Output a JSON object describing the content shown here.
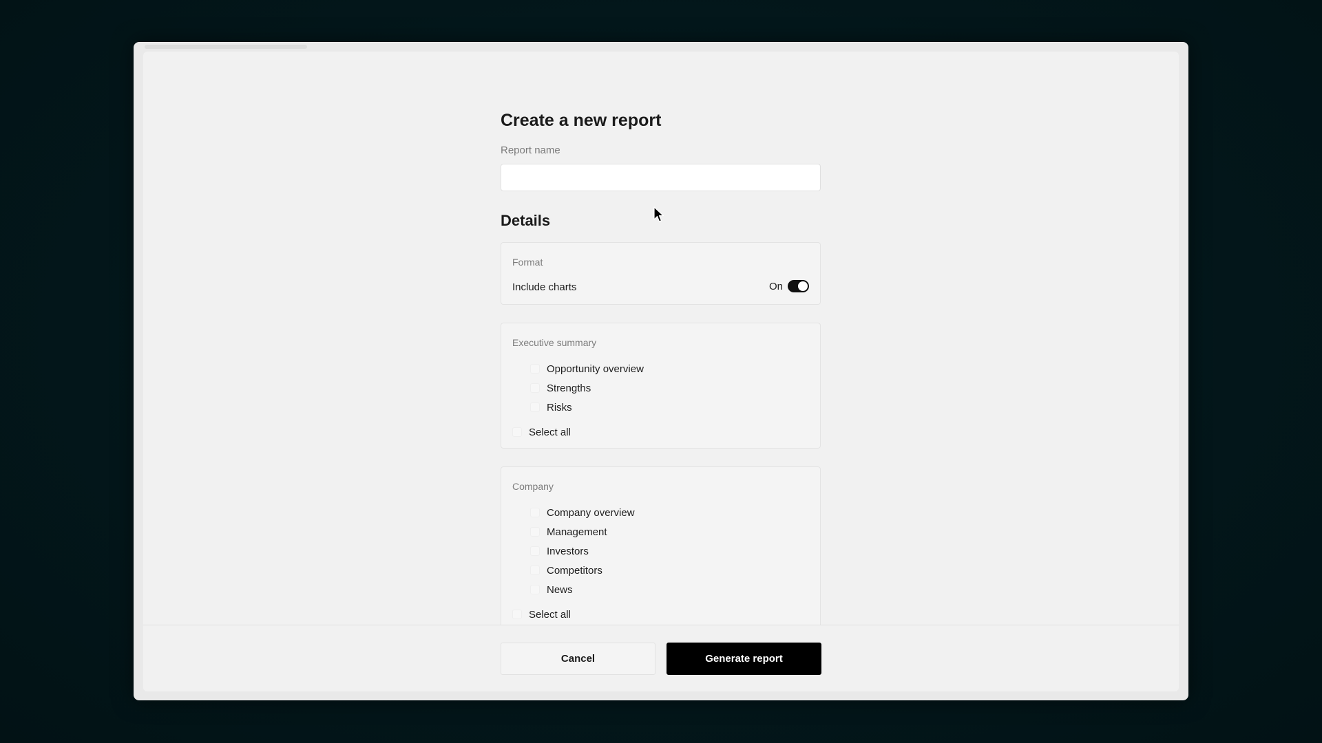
{
  "form": {
    "title": "Create a new report",
    "report_name_label": "Report name",
    "report_name_value": "",
    "details_heading": "Details"
  },
  "format": {
    "title": "Format",
    "include_charts_label": "Include charts",
    "toggle_state_label": "On",
    "include_charts_on": true
  },
  "executive_summary": {
    "title": "Executive summary",
    "items": [
      "Opportunity overview",
      "Strengths",
      "Risks"
    ],
    "select_all_label": "Select all"
  },
  "company": {
    "title": "Company",
    "items": [
      "Company overview",
      "Management",
      "Investors",
      "Competitors",
      "News"
    ],
    "select_all_label": "Select all"
  },
  "footer": {
    "cancel_label": "Cancel",
    "generate_label": "Generate report"
  },
  "colors": {
    "primary_button": "#000000",
    "background": "#03171b",
    "panel": "#f1f1f1"
  }
}
